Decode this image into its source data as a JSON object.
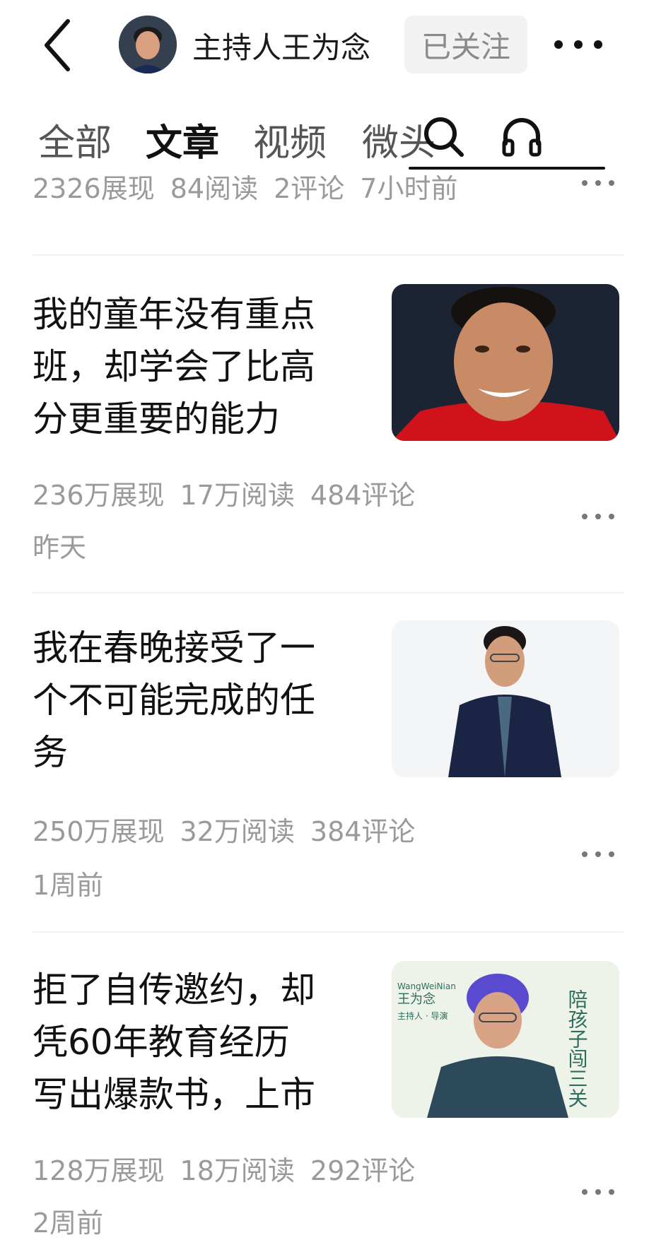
{
  "header": {
    "back_icon": "chevron-left-icon",
    "author_name": "主持人王为念",
    "follow_label": "已关注",
    "more_icon": "more-horizontal-icon"
  },
  "tabs": {
    "items": [
      {
        "label": "全部",
        "active": false
      },
      {
        "label": "文章",
        "active": true
      },
      {
        "label": "视频",
        "active": false
      },
      {
        "label": "微头",
        "active": false
      }
    ],
    "search_icon": "search-icon",
    "audio_icon": "headphones-icon"
  },
  "top_item": {
    "stats": [
      "2326展现",
      "84阅读",
      "2评论",
      "7小时前"
    ]
  },
  "articles": [
    {
      "title_lines": [
        "我的童年没有重点",
        "班，却学会了比高",
        "分更重要的能力"
      ],
      "stats": [
        "236万展现",
        "17万阅读",
        "484评论"
      ],
      "time": "昨天",
      "thumb": "portrait-red-shirt"
    },
    {
      "title_lines": [
        "我在春晚接受了一",
        "个不可能完成的任",
        "务"
      ],
      "stats": [
        "250万展现",
        "32万阅读",
        "384评论"
      ],
      "time": "1周前",
      "thumb": "portrait-suit"
    },
    {
      "title_lines": [
        "拒了自传邀约，却",
        "凭60年教育经历",
        "写出爆款书，上市"
      ],
      "stats": [
        "128万展现",
        "18万阅读",
        "292评论"
      ],
      "time": "2周前",
      "thumb": "book-cover-portrait",
      "thumb_text": {
        "pinyin": "WangWeiNian",
        "name": "王为念",
        "role": "主持人 · 导演",
        "book_title": "陪孩子闯三关"
      }
    }
  ],
  "colors": {
    "text_primary": "#111111",
    "text_secondary": "#9a9a9a",
    "follow_bg": "#f2f2f2",
    "divider": "#f0f0f0"
  }
}
